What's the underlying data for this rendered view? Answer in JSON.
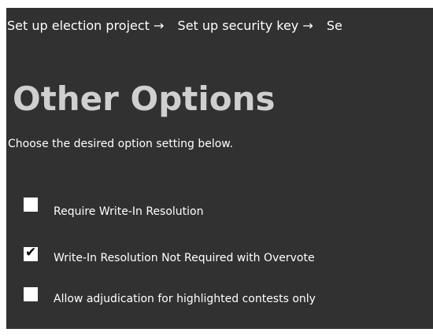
{
  "breadcrumb": {
    "items": [
      "Set up election project →",
      "Set up security key →",
      "Se"
    ]
  },
  "page": {
    "title": "Other Options",
    "subtitle": "Choose the desired option setting below."
  },
  "options": [
    {
      "label": "Require Write-In Resolution",
      "checked": false
    },
    {
      "label": "Write-In Resolution Not Required with Overvote",
      "checked": true
    },
    {
      "label": "Allow adjudication for highlighted contests only",
      "checked": false
    }
  ],
  "check_glyph": "✔",
  "colors": {
    "panel_background": "#313131",
    "title_text": "#cfcfcf",
    "body_text": "#ffffff",
    "checkbox_fill": "#ffffff"
  }
}
